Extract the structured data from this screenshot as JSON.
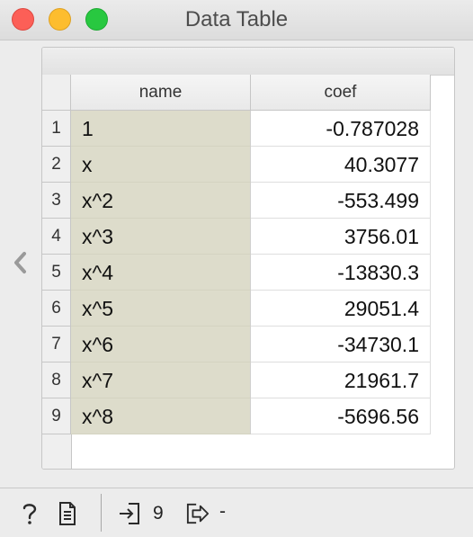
{
  "window": {
    "title": "Data Table"
  },
  "table": {
    "columns": [
      "name",
      "coef"
    ],
    "rows": [
      {
        "num": "1",
        "name": "1",
        "coef": "-0.787028"
      },
      {
        "num": "2",
        "name": "x",
        "coef": "40.3077"
      },
      {
        "num": "3",
        "name": "x^2",
        "coef": "-553.499"
      },
      {
        "num": "4",
        "name": "x^3",
        "coef": "3756.01"
      },
      {
        "num": "5",
        "name": "x^4",
        "coef": "-13830.3"
      },
      {
        "num": "6",
        "name": "x^5",
        "coef": "29051.4"
      },
      {
        "num": "7",
        "name": "x^6",
        "coef": "-34730.1"
      },
      {
        "num": "8",
        "name": "x^7",
        "coef": "21961.7"
      },
      {
        "num": "9",
        "name": "x^8",
        "coef": "-5696.56"
      }
    ]
  },
  "statusbar": {
    "input_count": "9",
    "output_count": "-"
  },
  "colors": {
    "name_cell_bg": "#dddccb",
    "close": "#fc5f57",
    "minimize": "#fdbd2e",
    "maximize": "#28c840"
  },
  "icons": [
    "help-icon",
    "report-icon",
    "input-icon",
    "output-icon",
    "chevron-left-icon"
  ]
}
